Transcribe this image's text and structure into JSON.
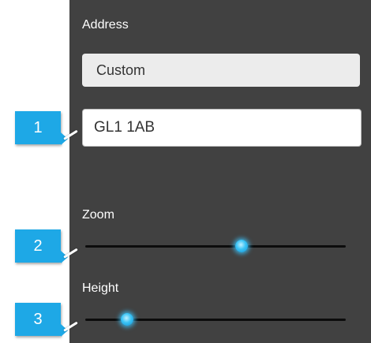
{
  "address": {
    "label": "Address",
    "mode_value": "Custom",
    "postcode_value": "GL1 1AB"
  },
  "zoom": {
    "label": "Zoom",
    "value_fraction": 0.6
  },
  "height": {
    "label": "Height",
    "value_fraction": 0.16
  },
  "callouts": [
    "1",
    "2",
    "3"
  ],
  "colors": {
    "panel_bg": "#414141",
    "accent": "#1ea8e6",
    "slider_track": "#0c0c0c"
  }
}
